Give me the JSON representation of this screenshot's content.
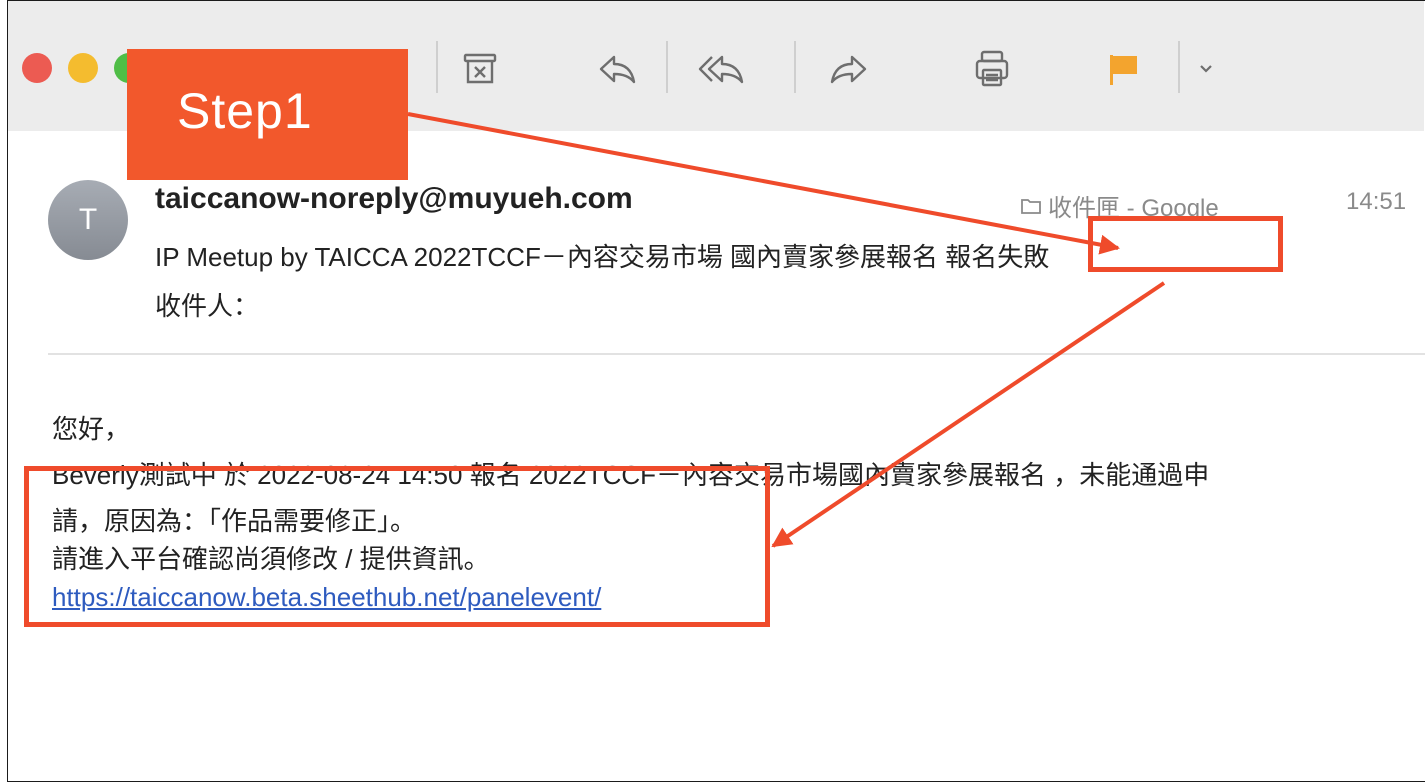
{
  "annotation": {
    "step_label": "Step1"
  },
  "colors": {
    "accent": "#ef4b2b",
    "step_bg": "#f2582c",
    "link": "#2e5bbf",
    "flag": "#f3a42e"
  },
  "toolbar": {
    "icons": [
      "archive-icon",
      "reply-icon",
      "reply-all-icon",
      "forward-icon",
      "print-icon",
      "flag-icon",
      "chevron-down-icon"
    ]
  },
  "email": {
    "avatar_initial": "T",
    "sender": "taiccanow-noreply@muyueh.com",
    "folder": "收件匣 - Google",
    "time": "14:51",
    "subject_main": "IP Meetup by TAICCA 2022TCCF－內容交易市場 國內賣家參展報名",
    "subject_status": "報名失敗",
    "recipient_label": "收件人："
  },
  "body": {
    "greeting": "您好，",
    "line1": "Beverly測試中 於 2022-08-24 14:50 報名 2022TCCF－內容交易市場國內賣家參展報名 ，未能通過申",
    "line2": "請，原因為：「作品需要修正」。",
    "line3": "請進入平台確認尚須修改 / 提供資訊。",
    "link": "https://taiccanow.beta.sheethub.net/panelevent/"
  }
}
